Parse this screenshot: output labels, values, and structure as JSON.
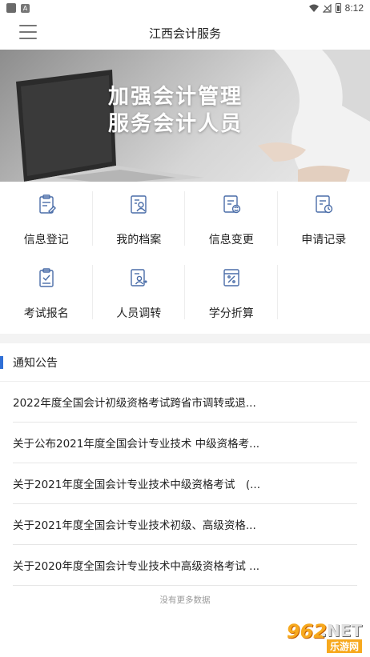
{
  "status_bar": {
    "time": "8:12",
    "icons": [
      "app-icon",
      "a-icon",
      "wifi-icon",
      "no-signal-icon",
      "battery-icon"
    ]
  },
  "header": {
    "title": "江西会计服务",
    "menu_icon": "hamburger-icon"
  },
  "banner": {
    "line1": "加强会计管理",
    "line2": "服务会计人员"
  },
  "grid": {
    "items": [
      {
        "label": "信息登记",
        "icon": "clipboard-edit-icon"
      },
      {
        "label": "我的档案",
        "icon": "profile-card-icon"
      },
      {
        "label": "信息变更",
        "icon": "document-sync-icon"
      },
      {
        "label": "申请记录",
        "icon": "document-clock-icon"
      },
      {
        "label": "考试报名",
        "icon": "clipboard-check-icon"
      },
      {
        "label": "人员调转",
        "icon": "person-transfer-icon"
      },
      {
        "label": "学分折算",
        "icon": "calculator-icon"
      }
    ]
  },
  "colors": {
    "accent": "#2f6fd6",
    "icon_stroke": "#4a6da8"
  },
  "notices": {
    "title": "通知公告",
    "items": [
      "2022年度全国会计初级资格考试跨省市调转或退...",
      "关于公布2021年度全国会计专业技术 中级资格考...",
      "关于2021年度全国会计专业技术中级资格考试　(...",
      "关于2021年度全国会计专业技术初级、高级资格...",
      "关于2020年度全国会计专业技术中高级资格考试 ..."
    ],
    "no_more": "没有更多数据"
  },
  "watermark": {
    "num": "962",
    "net": ".NET",
    "sub": "乐游网"
  }
}
